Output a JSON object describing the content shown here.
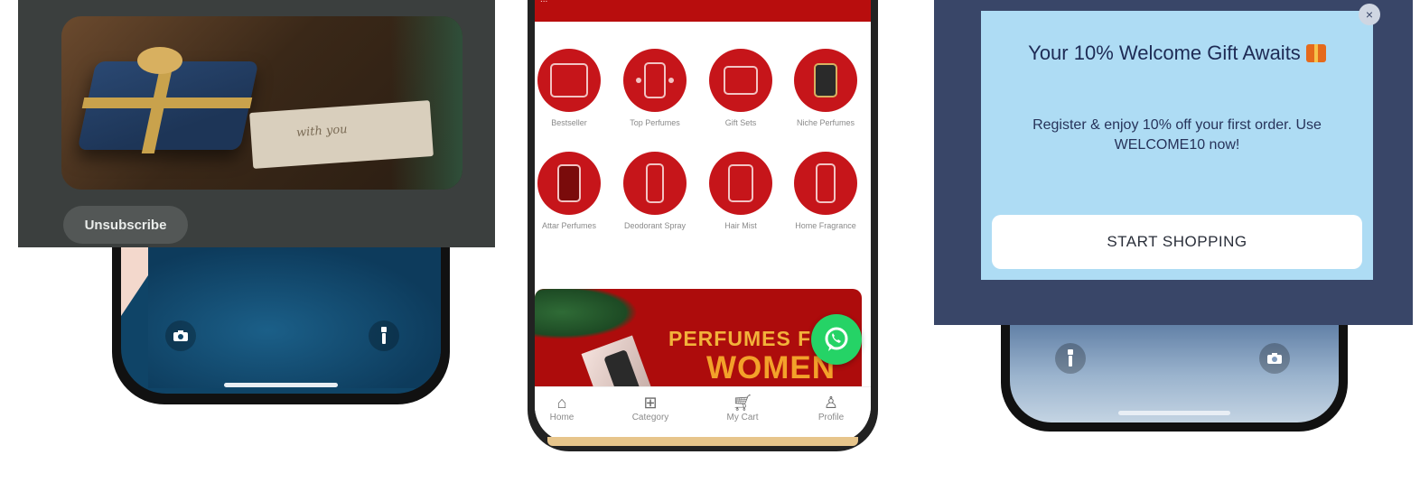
{
  "left_notification": {
    "image_caption": "with you",
    "unsubscribe_label": "Unsubscribe"
  },
  "center_app": {
    "header_text": "...",
    "categories": [
      {
        "label": "Bestseller"
      },
      {
        "label": "Top Perfumes"
      },
      {
        "label": "Gift Sets"
      },
      {
        "label": "Niche Perfumes"
      },
      {
        "label": "Attar Perfumes"
      },
      {
        "label": "Deodorant Spray"
      },
      {
        "label": "Hair Mist"
      },
      {
        "label": "Home Fragrance"
      }
    ],
    "banner": {
      "line1": "PERFUMES FOR",
      "line2": "WOMEN"
    },
    "nav": [
      {
        "label": "Home",
        "icon": "home-icon"
      },
      {
        "label": "Category",
        "icon": "category-icon"
      },
      {
        "label": "My Cart",
        "icon": "cart-icon"
      },
      {
        "label": "Profile",
        "icon": "profile-icon"
      }
    ],
    "whatsapp_icon": "whatsapp-icon"
  },
  "right_popup": {
    "title": "Your 10% Welcome Gift Awaits",
    "body": "Register & enjoy 10% off your first order. Use WELCOME10 now!",
    "button_label": "START SHOPPING",
    "close_symbol": "×"
  },
  "colors": {
    "brand_red": "#c6151a",
    "popup_bg": "#aedcf4",
    "panel_navy": "#394668",
    "whatsapp_green": "#25d366"
  }
}
